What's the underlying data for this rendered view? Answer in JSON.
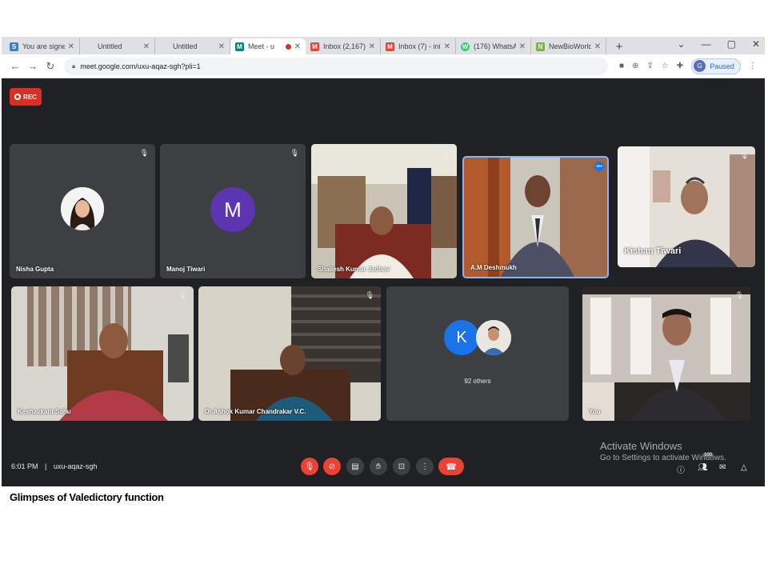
{
  "browser": {
    "tabs": [
      {
        "title": "You are signe",
        "favicon": "S",
        "color": "#3f7ec1",
        "active": false
      },
      {
        "title": "Untitled",
        "favicon": "",
        "color": "",
        "active": false
      },
      {
        "title": "Untitled",
        "favicon": "",
        "color": "",
        "active": false
      },
      {
        "title": "Meet - u",
        "favicon": "M",
        "color": "#00897b",
        "active": true,
        "recording": true
      },
      {
        "title": "Inbox (2,167)",
        "favicon": "M",
        "color": "#ea4335",
        "active": false
      },
      {
        "title": "Inbox (7) - ini",
        "favicon": "M",
        "color": "#ea4335",
        "active": false
      },
      {
        "title": "(176) WhatsA",
        "favicon": "W",
        "color": "#25d366",
        "active": false
      },
      {
        "title": "NewBioWorld",
        "favicon": "N",
        "color": "#7cb342",
        "active": false
      }
    ],
    "new_tab": "+",
    "url": "meet.google.com/uxu-aqaz-sgh?pli=1",
    "profile_initial": "G",
    "profile_status": "Paused",
    "icon_names": [
      "back-icon",
      "forward-icon",
      "reload-icon",
      "lock-icon",
      "camera-icon",
      "zoom-icon",
      "share-icon",
      "star-icon",
      "extension-icon",
      "menu-icon"
    ]
  },
  "meet": {
    "rec_label": "REC",
    "participants": [
      {
        "name": "Nisha Gupta"
      },
      {
        "name": "Manoj Tiwari",
        "initial": "M"
      },
      {
        "name": "Shailesh Kumar Jadhav"
      },
      {
        "name": "A.M Deshmukh"
      },
      {
        "name": "Kishan Tiwari"
      },
      {
        "name": "Keshavkant Sahu"
      },
      {
        "name": "Dr.Ashok Kumar Chandrakar V.C."
      },
      {
        "name": "You"
      }
    ],
    "others": {
      "initial": "K",
      "label": "92 others"
    },
    "time": "6:01 PM",
    "separator": "|",
    "meeting_code": "uxu-aqaz-sgh",
    "participant_badge": "100",
    "activate_title": "Activate Windows",
    "activate_sub": "Go to Settings to activate Windows."
  },
  "caption": "Glimpses of Valedictory function"
}
